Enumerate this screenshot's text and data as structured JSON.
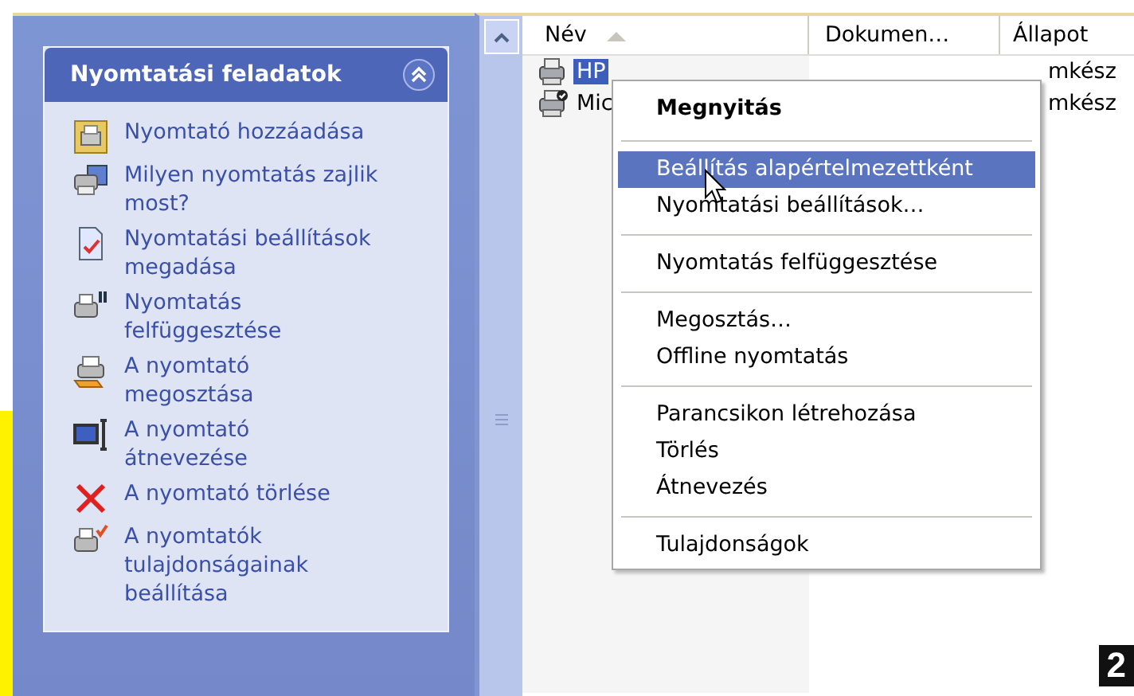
{
  "task_panel": {
    "title": "Nyomtatási feladatok",
    "collapsed": false,
    "items": [
      {
        "label": "Nyomtató hozzáadása"
      },
      {
        "label": "Milyen nyomtatás zajlik most?"
      },
      {
        "label": "Nyomtatási beállítások megadása"
      },
      {
        "label": "Nyomtatás felfüggesztése"
      },
      {
        "label": "A nyomtató megosztása"
      },
      {
        "label": "A nyomtató átnevezése"
      },
      {
        "label": "A nyomtató törlése"
      },
      {
        "label": "A nyomtatók tulajdonságainak beállítása"
      }
    ]
  },
  "list": {
    "columns": [
      {
        "label": "Név",
        "sorted": true
      },
      {
        "label": "Dokumen…",
        "sorted": false
      },
      {
        "label": "Állapot",
        "sorted": false
      }
    ],
    "rows": [
      {
        "name": "HP",
        "status": "mkész",
        "selected": true,
        "default_printer": false
      },
      {
        "name": "Mic",
        "status": "mkész",
        "selected": false,
        "default_printer": true
      }
    ]
  },
  "context_menu": {
    "groups": [
      [
        {
          "label": "Megnyitás",
          "default": true,
          "selected": false
        }
      ],
      [
        {
          "label": "Beállítás alapértelmezettként",
          "default": false,
          "selected": true
        },
        {
          "label": "Nyomtatási beállítások…",
          "default": false,
          "selected": false
        }
      ],
      [
        {
          "label": "Nyomtatás felfüggesztése",
          "default": false,
          "selected": false
        }
      ],
      [
        {
          "label": "Megosztás…",
          "default": false,
          "selected": false
        },
        {
          "label": "Offline nyomtatás",
          "default": false,
          "selected": false
        }
      ],
      [
        {
          "label": "Parancsikon létrehozása",
          "default": false,
          "selected": false
        },
        {
          "label": "Törlés",
          "default": false,
          "selected": false
        },
        {
          "label": "Átnevezés",
          "default": false,
          "selected": false
        }
      ],
      [
        {
          "label": "Tulajdonságok",
          "default": false,
          "selected": false
        }
      ]
    ]
  },
  "figure_number": "2"
}
